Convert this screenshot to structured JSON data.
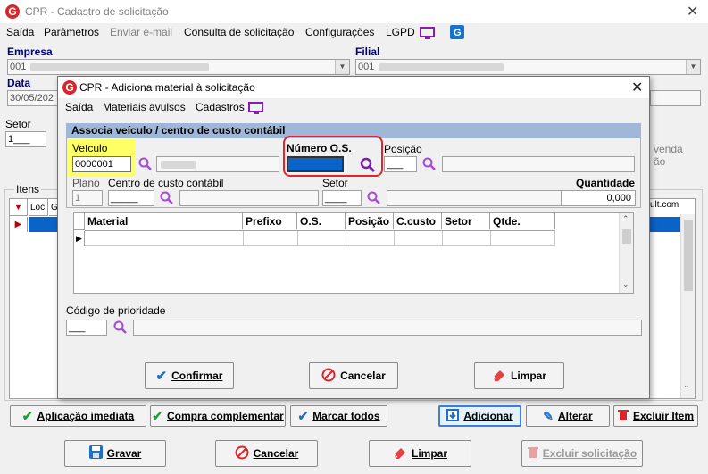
{
  "main_window": {
    "title": "CPR - Cadastro de solicitação",
    "menu": [
      "Saída",
      "Parâmetros",
      "Enviar e-mail",
      "Consulta de solicitação",
      "Configurações",
      "LGPD"
    ],
    "empresa_label": "Empresa",
    "empresa_value": "001",
    "filial_label": "Filial",
    "filial_value": "001",
    "data_label": "Data",
    "data_value": "30/05/202",
    "setor_label": "Setor",
    "setor_value": "1___",
    "itens_label": "Itens",
    "items_cols": [
      "Loc",
      "G"
    ],
    "right_text_1": "venda",
    "right_text_2": "ão",
    "right_text_3": "ult.com",
    "action_buttons": [
      "Aplicação imediata",
      "Compra complementar",
      "Marcar todos",
      "Adicionar",
      "Alterar",
      "Excluir Item"
    ],
    "bottom_buttons": [
      "Gravar",
      "Cancelar",
      "Limpar",
      "Excluir solicitação"
    ]
  },
  "dialog": {
    "title": "CPR - Adiciona material à solicitação",
    "menu": [
      "Saída",
      "Materiais avulsos",
      "Cadastros"
    ],
    "section_title": "Associa veículo / centro de custo contábil",
    "veiculo_label": "Veículo",
    "veiculo_value": "0000001",
    "numero_os_label": "Número O.S.",
    "numero_os_value": "",
    "posicao_label": "Posição",
    "posicao_value": "___",
    "plano_label": "Plano",
    "plano_value": "1",
    "centro_custo_label": "Centro de custo contábil",
    "centro_custo_value": "_____",
    "setor_label": "Setor",
    "setor_value": "____",
    "quantidade_label": "Quantidade",
    "quantidade_value": "0,000",
    "grid_columns": [
      "Material",
      "Prefixo",
      "O.S.",
      "Posição",
      "C.custo",
      "Setor",
      "Qtde."
    ],
    "prioridade_label": "Código de prioridade",
    "prioridade_value": "___",
    "buttons": [
      "Confirmar",
      "Cancelar",
      "Limpar"
    ]
  },
  "colors": {
    "brand_red": "#d6282c",
    "highlight_yellow": "#ffff66",
    "selection_blue": "#0a63c9",
    "annotation_red": "#e0262a",
    "section_blue": "#9fb8d8"
  }
}
